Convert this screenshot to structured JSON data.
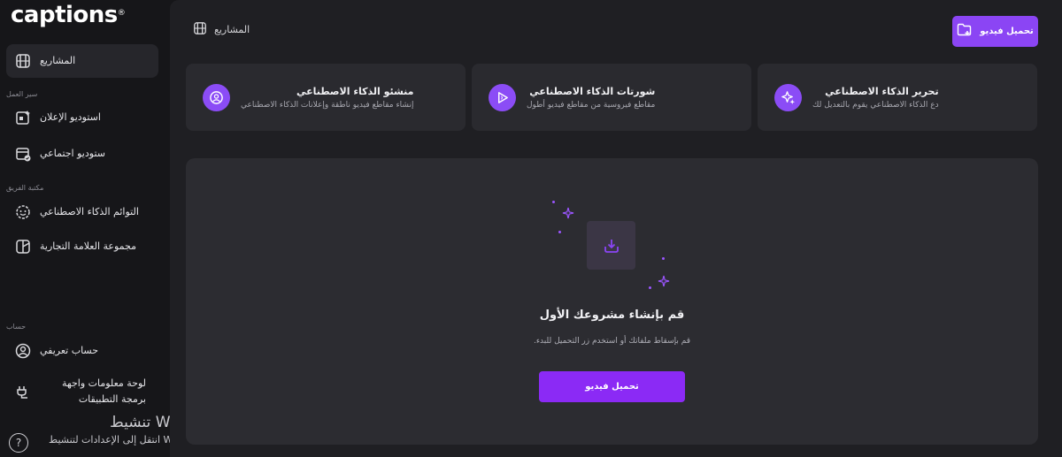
{
  "brand": {
    "logo_text": "captions",
    "logo_mark": "®"
  },
  "sidebar": {
    "projects": "المشاريع",
    "section_workflow": "سير العمل",
    "ad_studio": "استوديو الإعلان",
    "social_studio": "ستوديو اجتماعي",
    "section_team": "مكتبة الفريق",
    "ai_twins": "التوائم الذكاء الاصطناعي",
    "brand_kit": "مجموعة العلامة التجارية",
    "section_account": "حساب",
    "profile": "حساب تعريفي",
    "api_dashboard": "لوحة معلومات واجهة برمجة التطبيقات",
    "help": "?"
  },
  "header": {
    "breadcrumb": "المشاريع",
    "upload_button": "تحميل فيديو"
  },
  "cards": [
    {
      "title": "منشئو الذكاء الاصطناعي",
      "desc": "إنشاء مقاطع فيديو ناطقة وإعلانات الذكاء الاصطناعي",
      "icon": "face-scan-icon"
    },
    {
      "title": "شورتات الذكاء الاصطناعي",
      "desc": "مقاطع فيروسية من مقاطع فيديو أطول",
      "icon": "play-sparkle-icon"
    },
    {
      "title": "تحرير الذكاء الاصطناعي",
      "desc": "دع الذكاء الاصطناعي يقوم بالتعديل لك",
      "icon": "sparkle-icon"
    }
  ],
  "empty_state": {
    "title": "قم بإنشاء مشروعك الأول",
    "subtitle": "قم بإسقاط ملفاتك أو استخدم زر التحميل للبدء.",
    "button": "تحميل فيديو"
  },
  "watermark": {
    "title": "تنشيط Windows",
    "subtitle": "انتقل إلى الإعدادات لتنشيط Windows."
  },
  "colors": {
    "accent": "#8b45f4",
    "card": "#2a2a2f",
    "background": "#161619"
  }
}
